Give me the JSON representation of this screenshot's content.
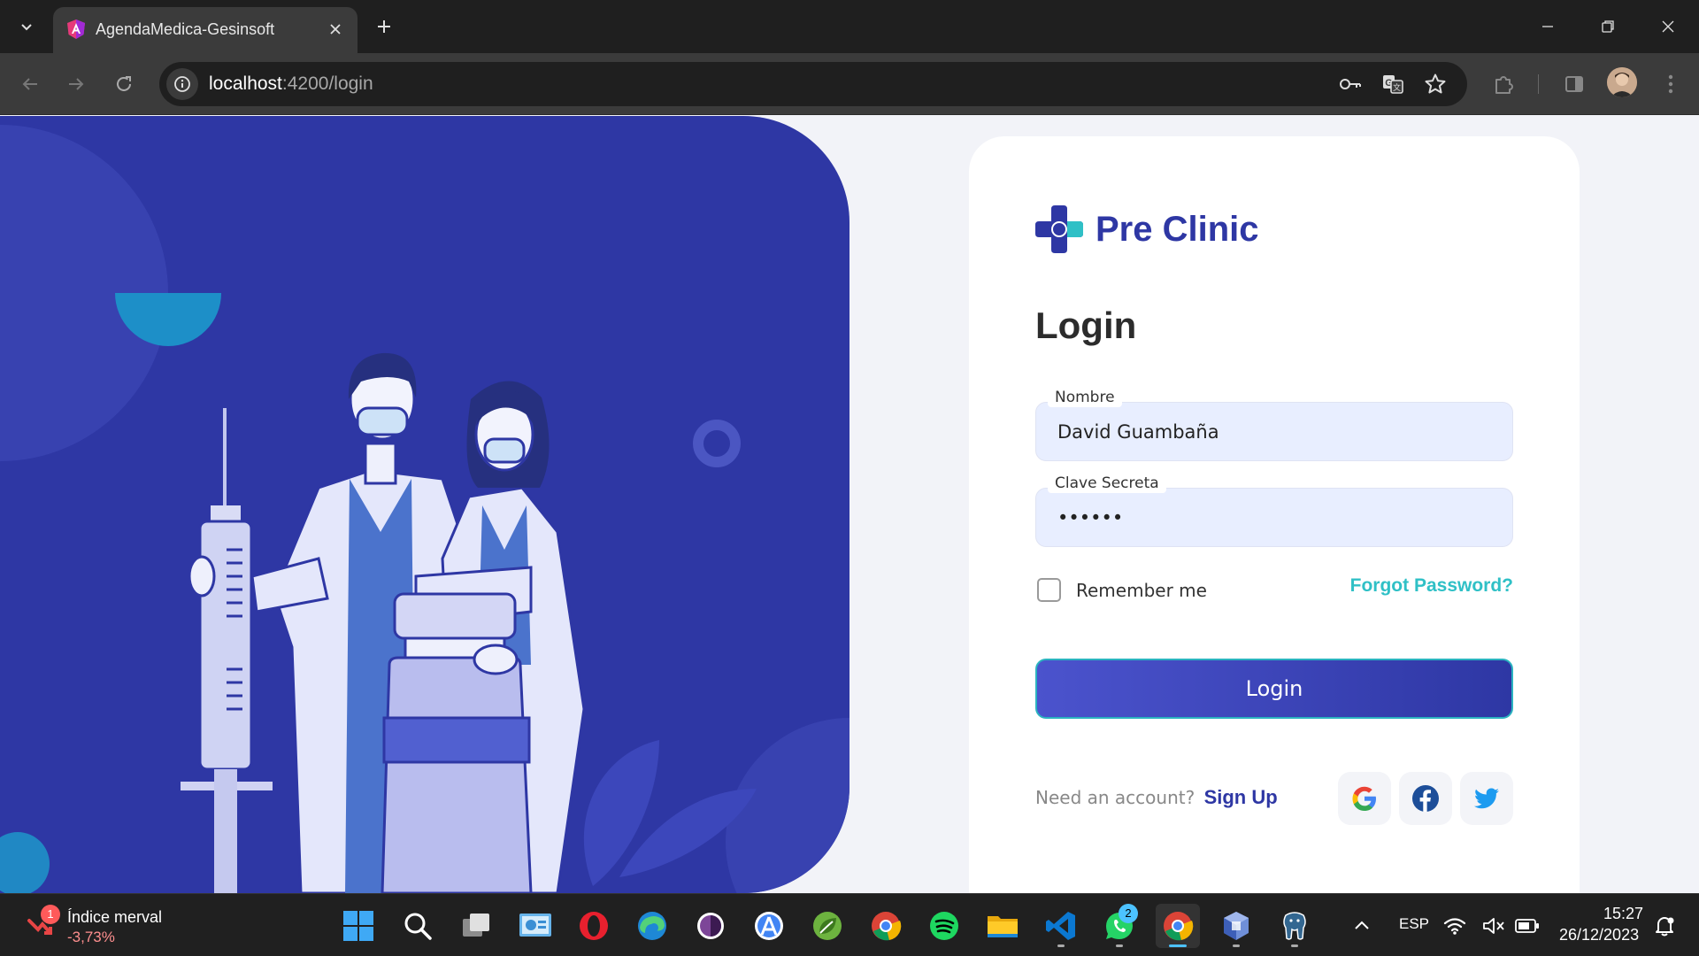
{
  "browser": {
    "tab": {
      "title": "AgendaMedica-Gesinsoft"
    },
    "url": {
      "host": "localhost",
      "rest": ":4200/login"
    }
  },
  "colors": {
    "brand": "#2e37a4",
    "accent": "#2fc0c6",
    "field_bg": "#e8eeff"
  },
  "login_page": {
    "logo_text": "Pre Clinic",
    "heading": "Login",
    "fields": {
      "nombre": {
        "label": "Nombre",
        "value": "David Guambaña"
      },
      "clave": {
        "label": "Clave Secreta",
        "value": "••••••"
      }
    },
    "remember_label": "Remember me",
    "remember_checked": false,
    "forgot_label": "Forgot Password?",
    "login_button": "Login",
    "signup_prompt": "Need an account?",
    "signup_link": "Sign Up",
    "social": [
      "google-icon",
      "facebook-icon",
      "twitter-icon"
    ]
  },
  "taskbar": {
    "widget": {
      "badge": "1",
      "title": "Índice merval",
      "value": "-3,73%"
    },
    "apps": [
      "windows-start",
      "search",
      "task-view",
      "control-panel",
      "opera",
      "edge",
      "tor-browser",
      "android-studio",
      "spring-tools",
      "chrome-profile",
      "spotify",
      "file-explorer",
      "vscode",
      "whatsapp",
      "chrome",
      "virtualbox",
      "pgadmin"
    ],
    "whatsapp_badge": "2",
    "language": "ESP",
    "time": "15:27",
    "date": "26/12/2023"
  }
}
